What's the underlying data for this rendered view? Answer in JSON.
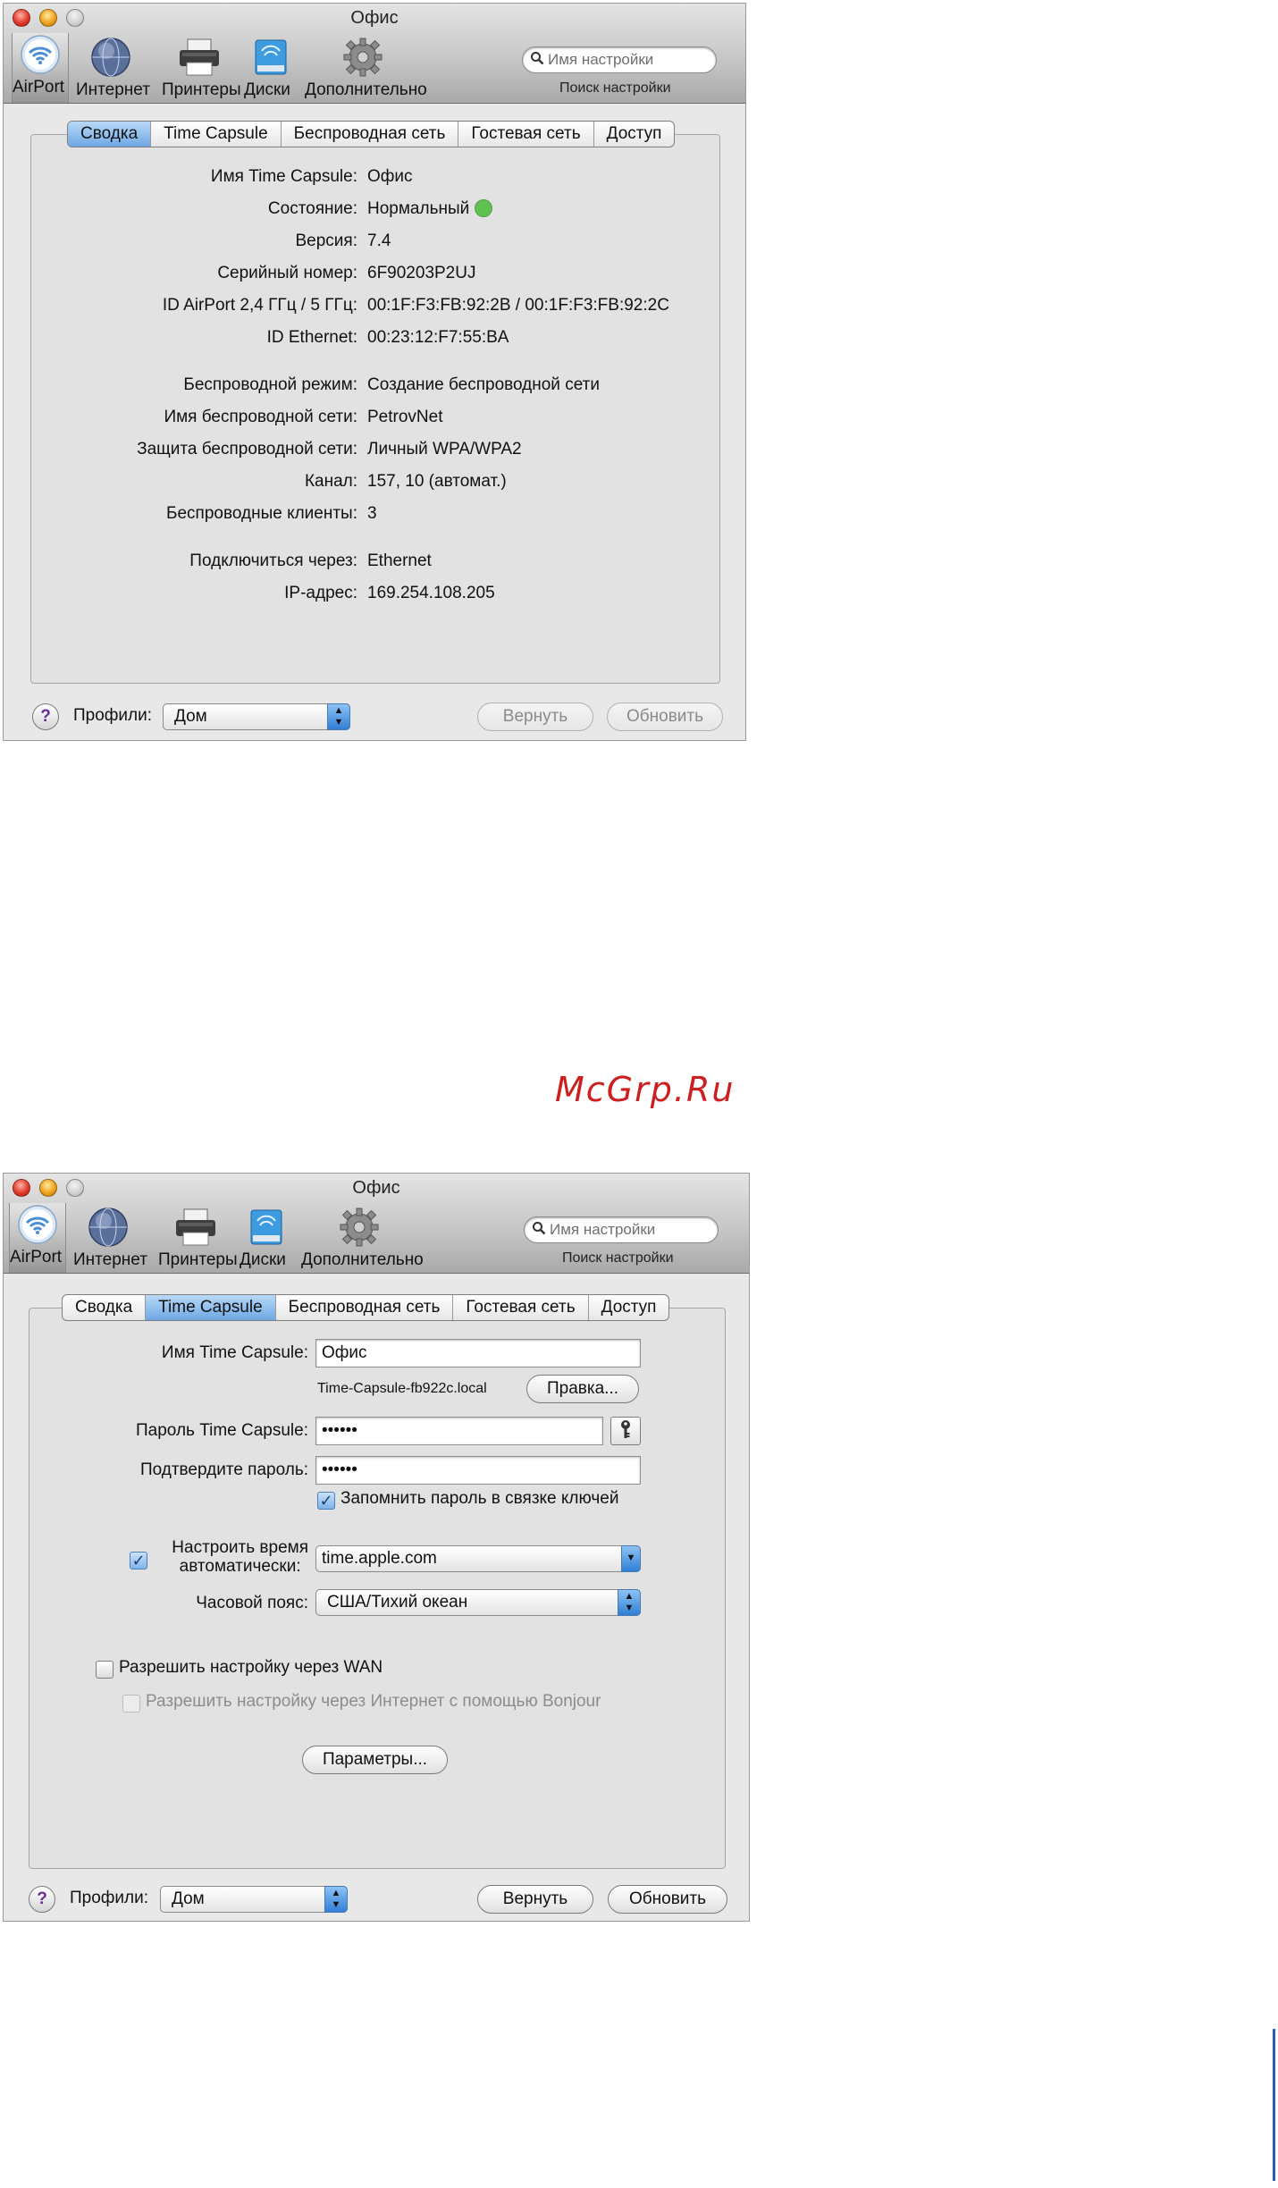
{
  "watermark": "McGrp.Ru",
  "window1": {
    "title": "Офис",
    "toolbar": {
      "items": [
        {
          "label": "AirPort",
          "icon": "airport-icon"
        },
        {
          "label": "Интернет",
          "icon": "globe-icon"
        },
        {
          "label": "Принтеры",
          "icon": "printer-icon"
        },
        {
          "label": "Диски",
          "icon": "disk-icon"
        },
        {
          "label": "Дополнительно",
          "icon": "gear-icon"
        }
      ],
      "search_placeholder": "Имя настройки",
      "search_label": "Поиск настройки"
    },
    "tabs": [
      "Сводка",
      "Time Capsule",
      "Беспроводная сеть",
      "Гостевая сеть",
      "Доступ"
    ],
    "active_tab": "Сводка",
    "summary": [
      {
        "key": "Имя Time Capsule:",
        "value": "Офис"
      },
      {
        "key": "Состояние:",
        "value": "Нормальный"
      },
      {
        "key": "Версия:",
        "value": "7.4"
      },
      {
        "key": "Серийный номер:",
        "value": "6F90203P2UJ"
      },
      {
        "key": "ID AirPort 2,4 ГГц / 5 ГГц:",
        "value": "00:1F:F3:FB:92:2B / 00:1F:F3:FB:92:2C"
      },
      {
        "key": "ID Ethernet:",
        "value": "00:23:12:F7:55:BA"
      },
      {
        "key": "Беспроводной режим:",
        "value": "Создание беспроводной сети"
      },
      {
        "key": "Имя беспроводной сети:",
        "value": "PetrovNet"
      },
      {
        "key": "Защита беспроводной сети:",
        "value": "Личный WPA/WPA2"
      },
      {
        "key": "Канал:",
        "value": "157, 10 (автомат.)"
      },
      {
        "key": "Беспроводные клиенты:",
        "value": "3"
      },
      {
        "key": "Подключиться через:",
        "value": "Ethernet"
      },
      {
        "key": "IP-адрес:",
        "value": "169.254.108.205"
      }
    ],
    "status_color": "#5fc14f",
    "footer": {
      "profiles_label": "Профили:",
      "profile_value": "Дом",
      "revert_label": "Вернуть",
      "update_label": "Обновить",
      "buttons_enabled": false
    }
  },
  "window2": {
    "title": "Офис",
    "toolbar": {
      "items": [
        {
          "label": "AirPort",
          "icon": "airport-icon"
        },
        {
          "label": "Интернет",
          "icon": "globe-icon"
        },
        {
          "label": "Принтеры",
          "icon": "printer-icon"
        },
        {
          "label": "Диски",
          "icon": "disk-icon"
        },
        {
          "label": "Дополнительно",
          "icon": "gear-icon"
        }
      ],
      "search_placeholder": "Имя настройки",
      "search_label": "Поиск настройки"
    },
    "tabs": [
      "Сводка",
      "Time Capsule",
      "Беспроводная сеть",
      "Гостевая сеть",
      "Доступ"
    ],
    "active_tab": "Time Capsule",
    "form": {
      "name_label": "Имя Time Capsule:",
      "name_value": "Офис",
      "hostname": "Time-Capsule-fb922c.local",
      "edit_label": "Правка...",
      "password_label": "Пароль Time Capsule:",
      "password_value": "••••••",
      "confirm_label": "Подтвердите пароль:",
      "confirm_value": "••••••",
      "remember_label": "Запомнить пароль в связке ключей",
      "remember_checked": true,
      "time_label_line1": "Настроить время",
      "time_label_line2": "автоматически:",
      "time_checked": true,
      "time_server": "time.apple.com",
      "timezone_label": "Часовой пояс:",
      "timezone_value": "США/Тихий океан",
      "wan_label": "Разрешить настройку через WAN",
      "wan_checked": false,
      "bonjour_label": "Разрешить настройку через Интернет с помощью Bonjour",
      "bonjour_checked": false,
      "params_label": "Параметры..."
    },
    "footer": {
      "profiles_label": "Профили:",
      "profile_value": "Дом",
      "revert_label": "Вернуть",
      "update_label": "Обновить",
      "buttons_enabled": true
    }
  }
}
